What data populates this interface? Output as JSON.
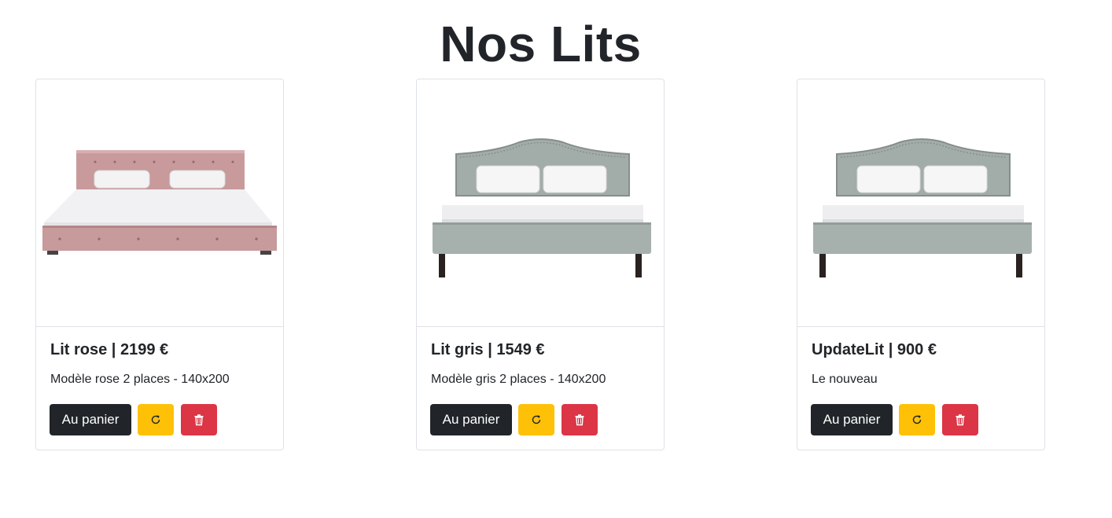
{
  "page": {
    "title": "Nos Lits"
  },
  "beds": [
    {
      "name": "Lit rose",
      "price": "2199 €",
      "title": "Lit rose | 2199 €",
      "description": "Modèle rose 2 places - 140x200",
      "color": "#c8a0a0"
    },
    {
      "name": "Lit gris",
      "price": "1549 €",
      "title": "Lit gris | 1549 €",
      "description": "Modèle gris 2 places - 140x200",
      "color": "#a6b0ac"
    },
    {
      "name": "UpdateLit",
      "price": "900 €",
      "title": "UpdateLit | 900 €",
      "description": "Le nouveau",
      "color": "#a6b0ac"
    }
  ],
  "buttons": {
    "cart_label": "Au panier",
    "update_icon": "refresh-icon",
    "delete_icon": "trash-icon"
  },
  "colors": {
    "primary_dark": "#212529",
    "warning": "#ffc107",
    "danger": "#dc3545"
  }
}
